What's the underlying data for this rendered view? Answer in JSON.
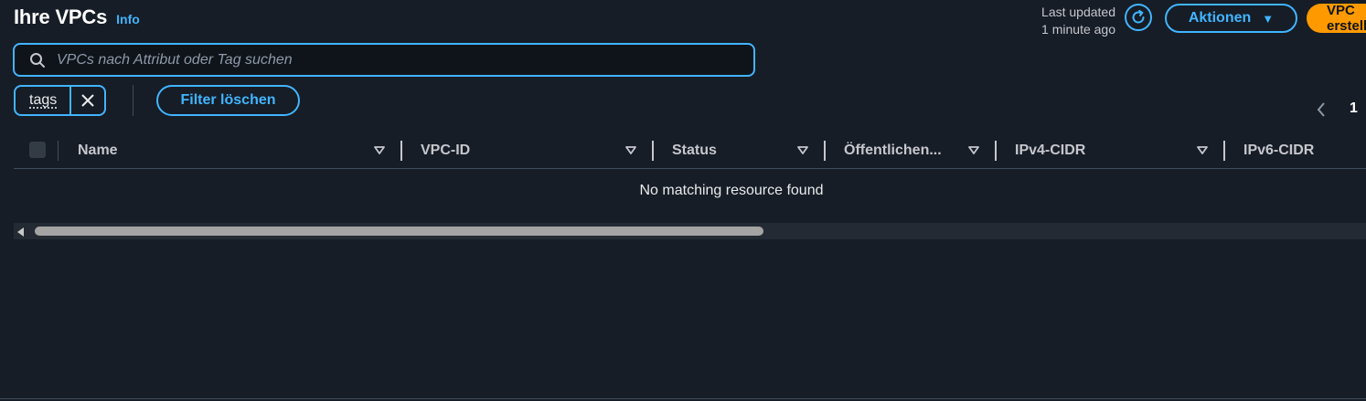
{
  "header": {
    "title": "Ihre VPCs",
    "info_label": "Info",
    "last_updated_line1": "Last updated",
    "last_updated_line2": "1 minute ago",
    "actions_label": "Aktionen",
    "create_label": "VPC erstellen"
  },
  "search": {
    "placeholder": "VPCs nach Attribut oder Tag suchen",
    "value": ""
  },
  "filters": {
    "tokens": [
      {
        "label": "tags"
      }
    ],
    "clear_label": "Filter löschen"
  },
  "pagination": {
    "current_page": "1"
  },
  "table": {
    "columns": [
      "Name",
      "VPC-ID",
      "Status",
      "Öffentlichen...",
      "IPv4-CIDR",
      "IPv6-CIDR"
    ],
    "empty_message": "No matching resource found"
  },
  "colors": {
    "background": "#161d26",
    "accent": "#42b4ff",
    "primary": "#ff9900"
  }
}
